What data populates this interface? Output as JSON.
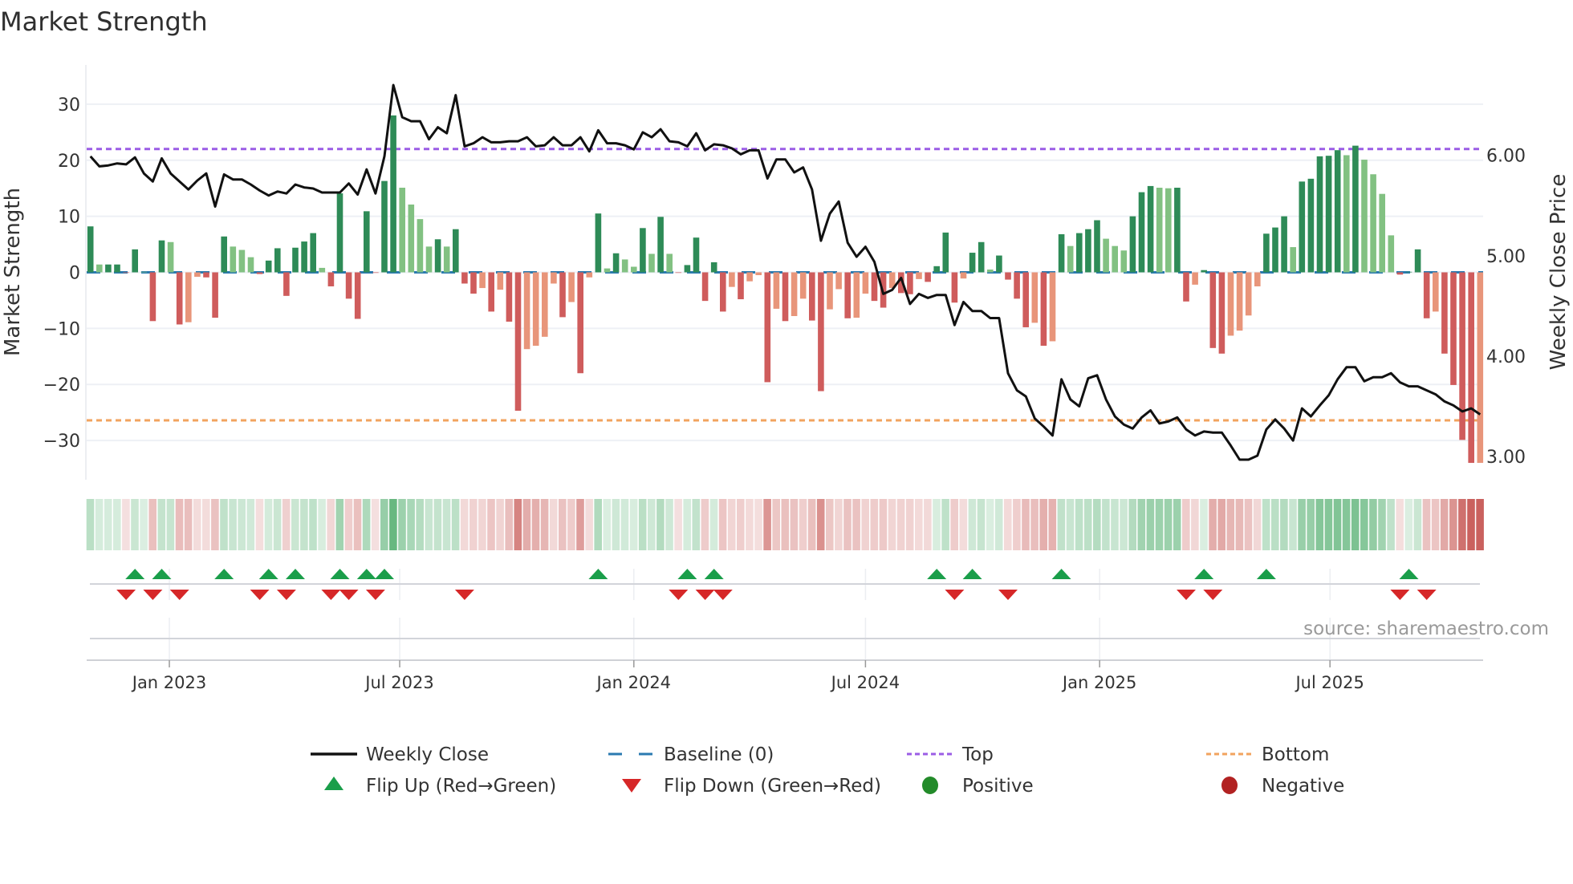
{
  "title": "Market Strength",
  "source": "source: sharemaestro.com",
  "legend": [
    {
      "label": "Weekly Close",
      "symbol": "line",
      "color": "#111111"
    },
    {
      "label": "Baseline (0)",
      "symbol": "dash",
      "color": "#2a7ab0"
    },
    {
      "label": "Top",
      "symbol": "dot",
      "color": "#9b5de5"
    },
    {
      "label": "Bottom",
      "symbol": "dot",
      "color": "#f2a35e"
    },
    {
      "label": "Flip Up (Red→Green)",
      "symbol": "triangle-up",
      "color": "#1a9e4a"
    },
    {
      "label": "Flip Down (Green→Red)",
      "symbol": "triangle-down",
      "color": "#d62728"
    },
    {
      "label": "Positive",
      "symbol": "circle",
      "color": "#238b2a"
    },
    {
      "label": "Negative",
      "symbol": "circle",
      "color": "#b22222"
    }
  ],
  "colors": {
    "pos_rising": "#2e8b57",
    "pos_falling": "#82c182",
    "neg_falling": "#cf5c5c",
    "neg_rising": "#e8957a",
    "heat_pos": "#3aa35a",
    "heat_neg": "#c4504c",
    "close": "#111111",
    "baseline": "#2a7ab0",
    "top": "#9b5de5",
    "bottom": "#f2a35e",
    "flip_up": "#1a9e4a",
    "flip_down": "#d62728"
  },
  "chart_data": {
    "type": "bar",
    "title": "Market Strength",
    "ylabel": "Market Strength",
    "y2label": "Weekly Close Price",
    "ylim": [
      -37,
      37
    ],
    "y2lim": [
      2.77,
      6.9
    ],
    "yticks": [
      "30",
      "20",
      "10",
      "0",
      "−10",
      "−20",
      "−30"
    ],
    "ytick_values": [
      30,
      20,
      10,
      0,
      -10,
      -20,
      -30
    ],
    "y2ticks": [
      "6.00",
      "5.00",
      "4.00",
      "3.00"
    ],
    "y2tick_values": [
      6,
      5,
      4,
      3
    ],
    "x_start": "2022-10-31",
    "x_step_days": 7,
    "xticks": [
      {
        "label": "Jan 2023",
        "date": "2023-01-01"
      },
      {
        "label": "Jul 2023",
        "date": "2023-07-01"
      },
      {
        "label": "Jan 2024",
        "date": "2024-01-01"
      },
      {
        "label": "Jul 2024",
        "date": "2024-07-01"
      },
      {
        "label": "Jan 2025",
        "date": "2025-01-01"
      },
      {
        "label": "Jul 2025",
        "date": "2025-07-01"
      }
    ],
    "top_level": 22,
    "bottom_level": -26.4,
    "baseline": 0,
    "strength": [
      8.2,
      1.4,
      1.4,
      1.4,
      -0.1,
      4.1,
      0.1,
      -8.7,
      5.7,
      5.4,
      -9.3,
      -8.9,
      -0.8,
      -0.9,
      -8.1,
      6.4,
      4.6,
      4.0,
      2.7,
      -0.3,
      2.1,
      4.3,
      -4.2,
      4.4,
      5.5,
      7.0,
      0.8,
      -2.5,
      14.1,
      -4.7,
      -8.3,
      10.9,
      -0.1,
      16.3,
      28.0,
      15.1,
      12.1,
      9.5,
      4.6,
      5.9,
      4.6,
      7.7,
      -2.0,
      -3.8,
      -2.8,
      -7.0,
      -3.1,
      -8.8,
      -24.7,
      -13.7,
      -13.1,
      -11.5,
      -2.0,
      -8.0,
      -5.3,
      -18.0,
      -0.9,
      10.5,
      0.7,
      3.4,
      2.3,
      1.0,
      7.9,
      3.3,
      9.9,
      3.3,
      -0.1,
      1.3,
      6.2,
      -5.1,
      1.8,
      -7.0,
      -2.6,
      -4.8,
      -1.6,
      -0.5,
      -19.6,
      -6.5,
      -8.7,
      -7.8,
      -4.7,
      -8.6,
      -21.2,
      -6.6,
      -3.0,
      -8.2,
      -8.1,
      -3.8,
      -5.1,
      -6.3,
      -2.8,
      -3.7,
      -3.9,
      -1.2,
      -1.7,
      1.1,
      7.1,
      -5.4,
      -1.1,
      3.5,
      5.4,
      0.5,
      3.0,
      -1.3,
      -4.7,
      -9.8,
      -9.0,
      -13.1,
      -12.3,
      6.8,
      4.7,
      7.0,
      7.7,
      9.3,
      6.0,
      4.7,
      3.9,
      10.0,
      14.3,
      15.4,
      15.1,
      15.0,
      15.1,
      -5.2,
      -2.2,
      0.4,
      -13.5,
      -14.5,
      -11.3,
      -10.4,
      -7.7,
      -2.5,
      6.9,
      8.0,
      10.0,
      4.5,
      16.2,
      16.7,
      20.7,
      20.8,
      21.8,
      20.9,
      22.6,
      20.1,
      17.5,
      14.0,
      6.6,
      -0.4,
      0.1,
      4.1,
      -8.2,
      -7.0,
      -14.5,
      -20.1,
      -29.9,
      -34.0,
      -34.0
    ],
    "weekly_close": [
      5.99,
      5.89,
      5.9,
      5.92,
      5.91,
      5.98,
      5.82,
      5.74,
      5.97,
      5.82,
      5.74,
      5.66,
      5.75,
      5.82,
      5.49,
      5.81,
      5.76,
      5.76,
      5.71,
      5.65,
      5.6,
      5.64,
      5.62,
      5.71,
      5.68,
      5.67,
      5.63,
      5.63,
      5.63,
      5.72,
      5.61,
      5.86,
      5.62,
      5.99,
      6.7,
      6.38,
      6.34,
      6.34,
      6.16,
      6.28,
      6.22,
      6.6,
      6.09,
      6.12,
      6.18,
      6.13,
      6.13,
      6.14,
      6.14,
      6.18,
      6.09,
      6.1,
      6.18,
      6.1,
      6.1,
      6.18,
      6.04,
      6.25,
      6.12,
      6.12,
      6.1,
      6.06,
      6.23,
      6.18,
      6.26,
      6.14,
      6.13,
      6.09,
      6.22,
      6.05,
      6.11,
      6.1,
      6.07,
      6.01,
      6.05,
      6.05,
      5.77,
      5.96,
      5.96,
      5.83,
      5.88,
      5.66,
      5.15,
      5.42,
      5.54,
      5.13,
      4.99,
      5.09,
      4.94,
      4.62,
      4.66,
      4.78,
      4.52,
      4.62,
      4.58,
      4.61,
      4.61,
      4.31,
      4.54,
      4.45,
      4.45,
      4.38,
      4.38,
      3.83,
      3.66,
      3.6,
      3.38,
      3.3,
      3.21,
      3.77,
      3.57,
      3.5,
      3.78,
      3.81,
      3.57,
      3.4,
      3.32,
      3.28,
      3.39,
      3.46,
      3.33,
      3.35,
      3.39,
      3.27,
      3.21,
      3.25,
      3.24,
      3.24,
      3.11,
      2.97,
      2.97,
      3.01,
      3.27,
      3.37,
      3.28,
      3.16,
      3.48,
      3.4,
      3.51,
      3.61,
      3.77,
      3.89,
      3.89,
      3.75,
      3.79,
      3.79,
      3.83,
      3.74,
      3.7,
      3.7,
      3.66,
      3.62,
      3.55,
      3.51,
      3.45,
      3.48,
      3.42
    ]
  }
}
